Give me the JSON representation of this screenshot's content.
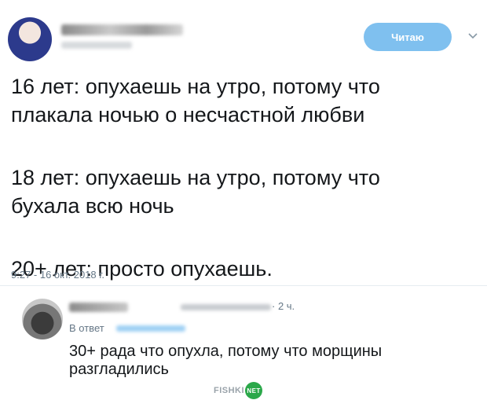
{
  "tweet": {
    "follow_label": "Читаю",
    "lines": {
      "a1": "16 лет: опухаешь на утро, потому что",
      "a2": "плакала ночью о несчастной любви",
      "b1": "18 лет: опухаешь на утро, потому что",
      "b2": "бухала всю ночь",
      "c1": "20+ лет: просто опухаешь."
    },
    "timestamp": "9:27 - 16 окт. 2018 г."
  },
  "reply": {
    "time": "· 2 ч.",
    "replying_prefix": "В ответ",
    "line1": "30+ рада что опухла, потому что морщины",
    "line2": "разгладились"
  },
  "watermark": {
    "brand": "FISHKI",
    "badge": "NET"
  },
  "colors": {
    "follow_button": "#7fc0ef",
    "secondary_text": "#657786",
    "watermark_badge": "#2ba84a"
  },
  "icons": {
    "menu": "chevron-down-icon"
  }
}
